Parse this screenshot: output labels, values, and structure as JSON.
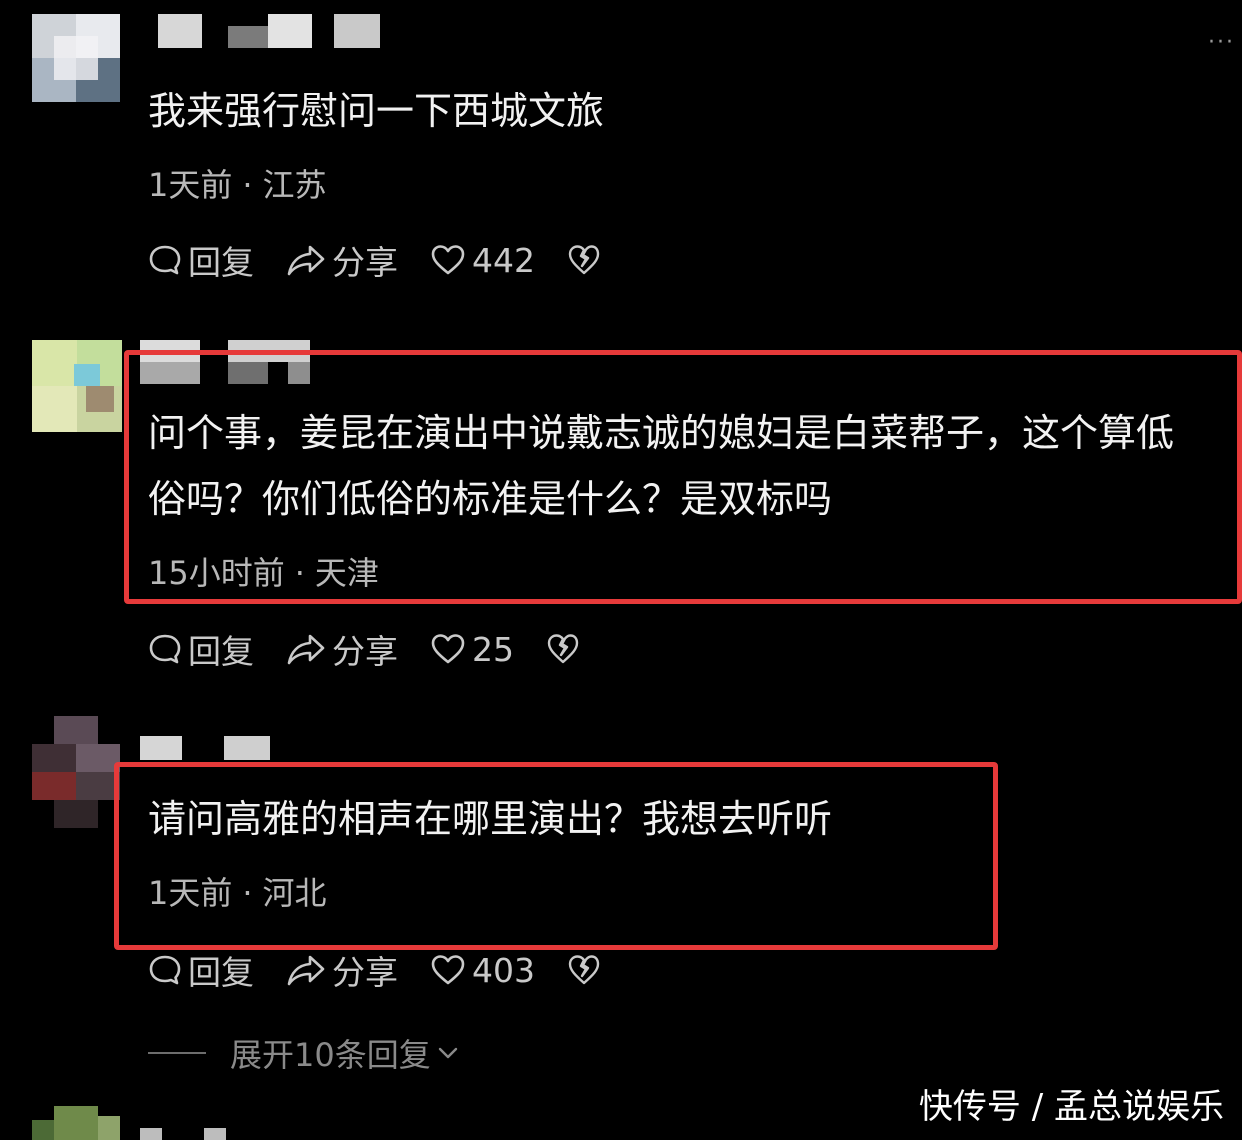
{
  "comments": [
    {
      "text_lines": [
        "我来强行慰问一下西城文旅"
      ],
      "time": "1天前",
      "location": "江苏",
      "reply_label": "回复",
      "share_label": "分享",
      "likes": "442"
    },
    {
      "text_lines": [
        "问个事，姜昆在演出中说戴志诚的媳妇是白菜帮子，这个算低",
        "俗吗？你们低俗的标准是什么？是双标吗"
      ],
      "time": "15小时前",
      "location": "天津",
      "reply_label": "回复",
      "share_label": "分享",
      "likes": "25"
    },
    {
      "text_lines": [
        "请问高雅的相声在哪里演出？我想去听听"
      ],
      "time": "1天前",
      "location": "河北",
      "reply_label": "回复",
      "share_label": "分享",
      "likes": "403"
    }
  ],
  "meta_separator": "·",
  "expand_replies_label": "展开10条回复",
  "more_menu_glyph": "···",
  "watermark": "快传号 / 孟总说娱乐",
  "colors": {
    "background": "#000000",
    "highlight": "#e63a3a",
    "text": "#f2f2f2",
    "meta": "#b8b8b8"
  },
  "icons": {
    "reply": "speech-bubble-icon",
    "share": "share-arrow-icon",
    "like": "heart-icon",
    "dislike": "broken-heart-icon",
    "expand": "chevron-down-icon"
  }
}
